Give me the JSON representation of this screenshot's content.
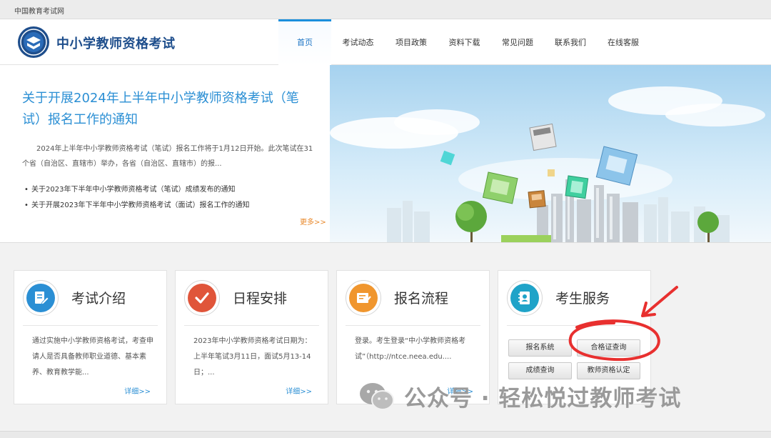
{
  "topbar": {
    "site_link": "中国教育考试网"
  },
  "header": {
    "title": "中小学教师资格考试",
    "nav": [
      "首页",
      "考试动态",
      "项目政策",
      "资料下载",
      "常见问题",
      "联系我们",
      "在线客服"
    ]
  },
  "banner": {
    "headline": "关于开展2024年上半年中小学教师资格考试（笔试）报名工作的通知",
    "summary": "2024年上半年中小学教师资格考试（笔试）报名工作将于1月12日开始。此次笔试在31个省（自治区、直辖市）举办，各省（自治区、直辖市）的报...",
    "news": [
      "关于2023年下半年中小学教师资格考试（笔试）成绩发布的通知",
      "关于开展2023年下半年中小学教师资格考试（面试）报名工作的通知"
    ],
    "more": "更多>>"
  },
  "cards": [
    {
      "title": "考试介绍",
      "text": "通过实施中小学教师资格考试，考查申请人是否具备教师职业道德、基本素养、教育教学能...",
      "more": "详细>>",
      "icon": "document-edit-icon",
      "color": "#2b8fd4"
    },
    {
      "title": "日程安排",
      "text": "2023年中小学教师资格考试日期为：上半年笔试3月11日，面试5月13-14日；...",
      "more": "详细>>",
      "icon": "checkmark-icon",
      "color": "#e0553a"
    },
    {
      "title": "报名流程",
      "text": "登录。考生登录“中小学教师资格考试”（http://ntce.neea.edu....",
      "more": "详细>>",
      "icon": "form-list-icon",
      "color": "#f0962e"
    },
    {
      "title": "考生服务",
      "icon": "contact-book-icon",
      "color": "#1fa3c8"
    }
  ],
  "services": [
    "报名系统",
    "合格证查询",
    "成绩查询",
    "教师资格认定"
  ],
  "watermark": {
    "text": "公众号 · 轻松悦过教师考试",
    "icon": "wechat-icon"
  },
  "annotation_color": "#e8302f"
}
